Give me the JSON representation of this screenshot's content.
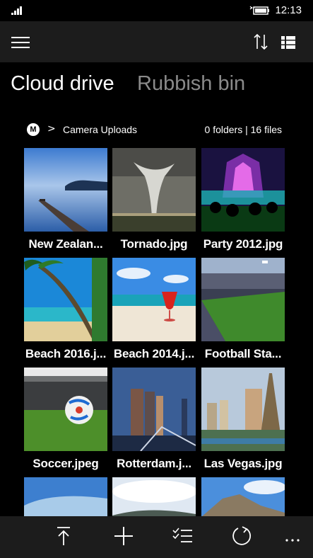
{
  "status": {
    "time": "12:13",
    "icons": [
      "signal-icon",
      "battery-icon"
    ]
  },
  "appbar": {
    "icons": [
      "hamburger-menu-icon",
      "sort-icon",
      "list-view-icon"
    ]
  },
  "tabs": [
    {
      "label": "Cloud drive",
      "active": true
    },
    {
      "label": "Rubbish bin",
      "active": false
    }
  ],
  "breadcrumb": {
    "logo": "M",
    "separator": ">",
    "folder": "Camera Uploads",
    "count": "0 folders | 16 files"
  },
  "files": [
    {
      "name": "New Zealan...",
      "thumb": "pier-lake"
    },
    {
      "name": "Tornado.jpg",
      "thumb": "tornado"
    },
    {
      "name": "Party 2012.jpg",
      "thumb": "concert"
    },
    {
      "name": "Beach 2016.j...",
      "thumb": "palm-beach"
    },
    {
      "name": "Beach 2014.j...",
      "thumb": "cocktail-beach"
    },
    {
      "name": "Football Sta...",
      "thumb": "stadium"
    },
    {
      "name": "Soccer.jpeg",
      "thumb": "soccer-ball"
    },
    {
      "name": "Rotterdam.j...",
      "thumb": "city-towers"
    },
    {
      "name": "Las Vegas.jpg",
      "thumb": "las-vegas"
    },
    {
      "name": "",
      "thumb": "sky"
    },
    {
      "name": "",
      "thumb": "mountain-clouds"
    },
    {
      "name": "",
      "thumb": "rocky-hill"
    }
  ],
  "bottombar": {
    "icons": [
      "upload-icon",
      "add-icon",
      "select-icon",
      "refresh-icon",
      "more-icon"
    ]
  },
  "colors": {
    "background": "#000000",
    "bar": "#1c1c1c",
    "inactive_tab": "#8a8a8a"
  }
}
